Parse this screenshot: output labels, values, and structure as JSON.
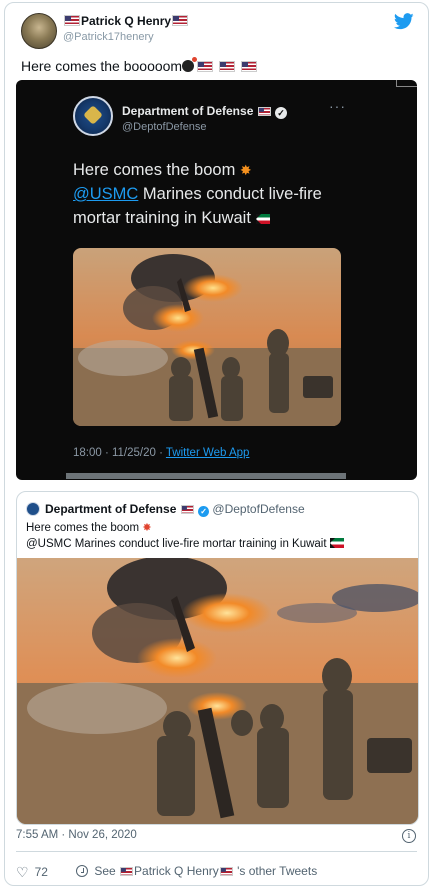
{
  "tweet": {
    "author_name": "Patrick Q Henry",
    "handle": "@Patrick17henery",
    "text": "Here comes the booooom",
    "twitter_icon": "twitter-bird-icon"
  },
  "embedded_screenshot": {
    "account_name": "Department of Defense",
    "account_handle": "@DeptofDefense",
    "line1": "Here comes the boom",
    "mention": "@USMC",
    "line2_rest": " Marines conduct live-fire",
    "line3": "mortar training in Kuwait",
    "timestamp": "18:00 · 11/25/20 · ",
    "app": "Twitter Web App"
  },
  "quoted_tweet": {
    "account_name": "Department of Defense",
    "account_handle": "@DeptofDefense",
    "line1": "Here comes the boom",
    "line2": "@USMC Marines conduct live-fire mortar training in Kuwait"
  },
  "footer": {
    "timestamp": "7:55 AM · Nov 26, 2020",
    "like_count": "72",
    "see_prefix": "See",
    "see_name": "Patrick Q Henry",
    "see_suffix": "'s other Tweets"
  },
  "colors": {
    "accent": "#1d9bf0",
    "text": "#0f1419",
    "muted": "#536471",
    "border": "#cfd9de"
  }
}
